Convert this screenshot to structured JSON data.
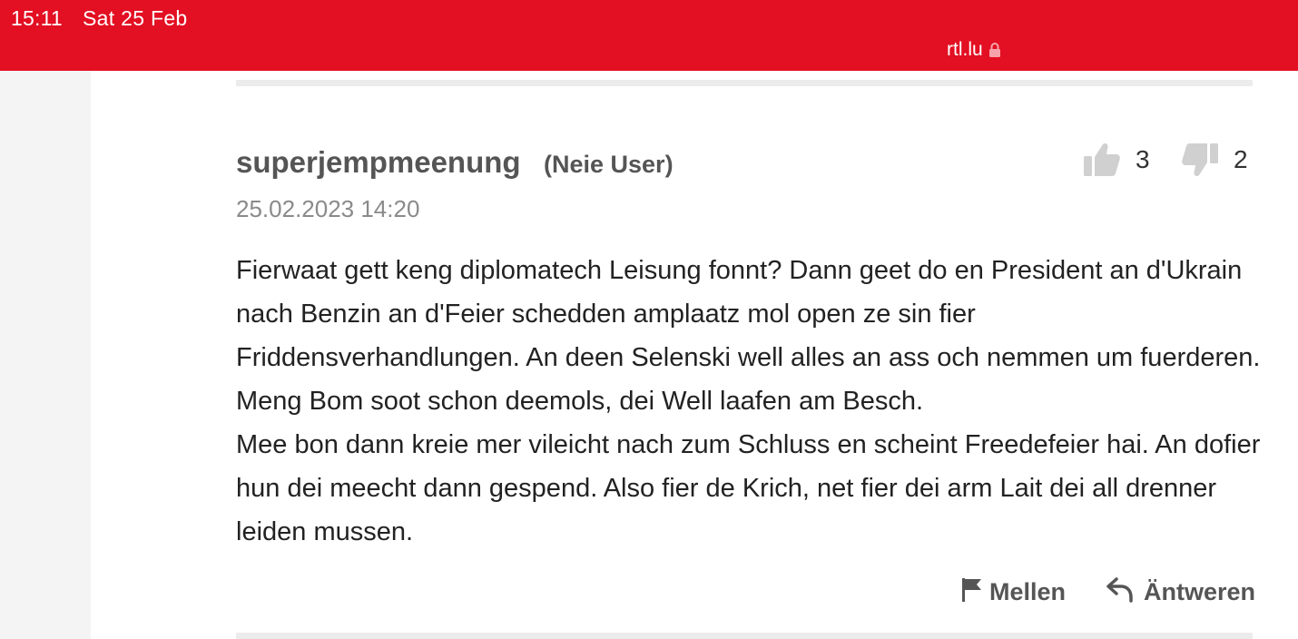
{
  "status_bar": {
    "time": "15:11",
    "date": "Sat 25 Feb",
    "url": "rtl.lu",
    "background_color": "#e30f22",
    "lock_icon": "lock-icon"
  },
  "comment": {
    "author": "superjempmeenung",
    "user_tag": "(Neie User)",
    "timestamp": "25.02.2023 14:20",
    "likes": "3",
    "dislikes": "2",
    "paragraphs": [
      "Fierwaat gett keng diplomatech Leisung fonnt? Dann geet do en President an d'Ukrain nach Benzin an d'Feier schedden amplaatz mol open ze sin fier Friddensverhandlungen. An deen Selenski well alles an ass och nemmen um fuerderen. Meng Bom soot schon deemols, dei Well laafen am Besch.",
      "Mee bon dann kreie mer vileicht nach zum Schluss en scheint Freedefeier hai. An dofier hun dei meecht dann gespend. Also fier de Krich, net fier dei arm Lait dei all drenner leiden mussen."
    ],
    "actions": {
      "report": "Mellen",
      "reply": "Äntweren"
    }
  }
}
